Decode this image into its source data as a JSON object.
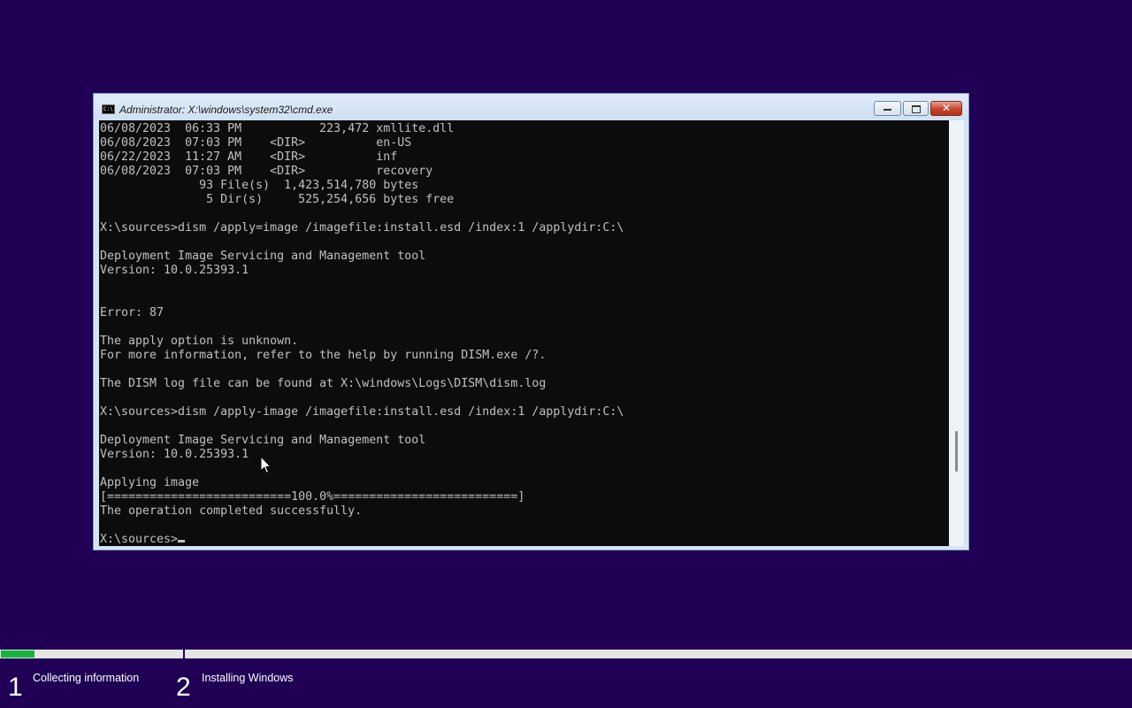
{
  "window": {
    "title": "Administrator: X:\\windows\\system32\\cmd.exe",
    "icon": "C:\\",
    "controls": {
      "minimize_icon": "minimize-icon",
      "maximize_icon": "maximize-icon",
      "close_icon": "close-icon",
      "close_glyph": "✕"
    },
    "scroll_position": 0.86
  },
  "console": {
    "lines": [
      "06/08/2023  06:33 PM           223,472 xmllite.dll",
      "06/08/2023  07:03 PM    <DIR>          en-US",
      "06/22/2023  11:27 AM    <DIR>          inf",
      "06/08/2023  07:03 PM    <DIR>          recovery",
      "              93 File(s)  1,423,514,780 bytes",
      "               5 Dir(s)     525,254,656 bytes free",
      "",
      "X:\\sources>dism /apply=image /imagefile:install.esd /index:1 /applydir:C:\\",
      "",
      "Deployment Image Servicing and Management tool",
      "Version: 10.0.25393.1",
      "",
      "",
      "Error: 87",
      "",
      "The apply option is unknown.",
      "For more information, refer to the help by running DISM.exe /?.",
      "",
      "The DISM log file can be found at X:\\windows\\Logs\\DISM\\dism.log",
      "",
      "X:\\sources>dism /apply-image /imagefile:install.esd /index:1 /applydir:C:\\",
      "",
      "Deployment Image Servicing and Management tool",
      "Version: 10.0.25393.1",
      "",
      "Applying image",
      "[==========================100.0%==========================]",
      "The operation completed successfully.",
      ""
    ],
    "prompt": "X:\\sources>"
  },
  "setup": {
    "progress_percent": 3,
    "steps": [
      {
        "number": "1",
        "label": "Collecting information"
      },
      {
        "number": "2",
        "label": "Installing Windows"
      }
    ]
  },
  "colors": {
    "desktop_background": "#1f0054",
    "console_background": "#0c0c0c",
    "console_text": "#c0c0c0",
    "progress_fill": "#17b33c",
    "close_button": "#c7452e"
  }
}
